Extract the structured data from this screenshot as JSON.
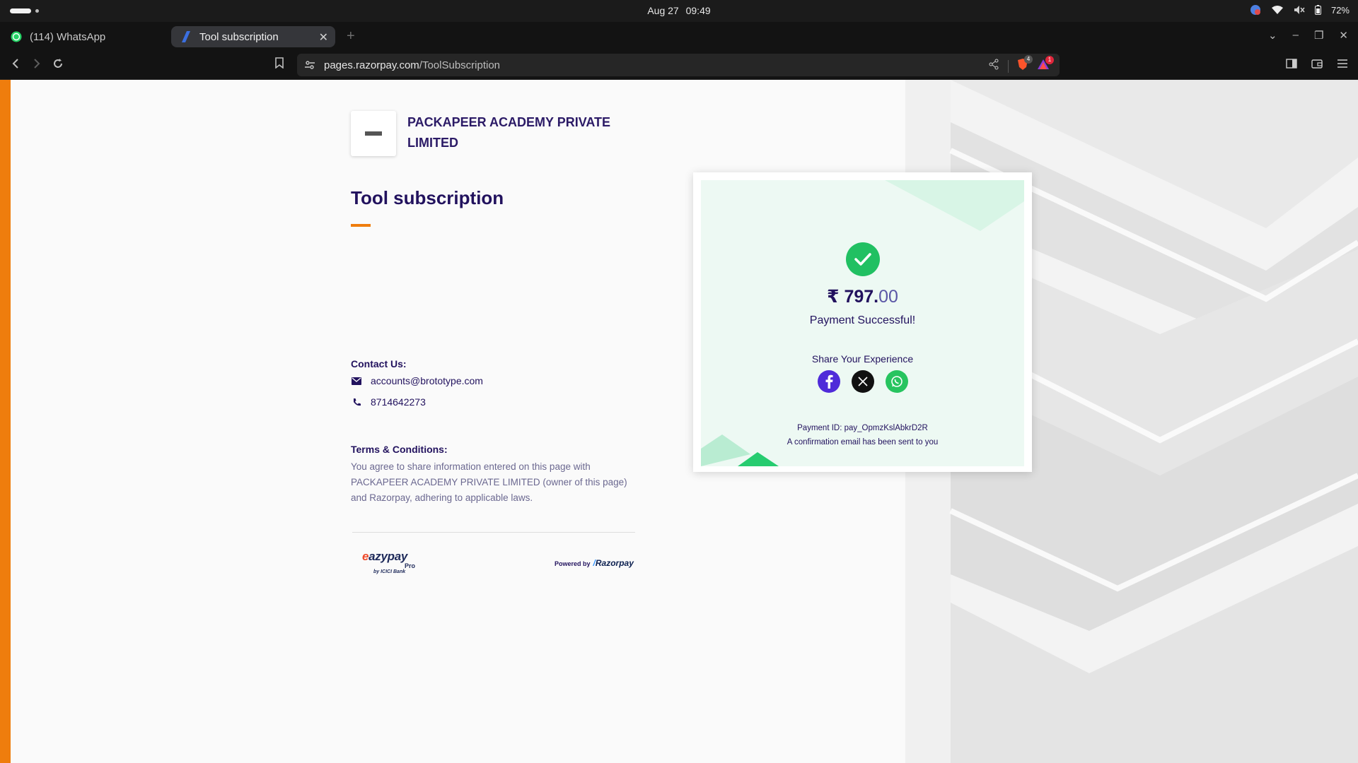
{
  "os": {
    "date": "Aug 27",
    "time": "09:49",
    "battery": "72%"
  },
  "browser": {
    "tabs": [
      {
        "label": "(114) WhatsApp",
        "icon": "whatsapp-icon",
        "active": false
      },
      {
        "label": "Tool subscription",
        "icon": "razorpay-icon",
        "active": true
      }
    ],
    "address": {
      "host": "pages.razorpay.com",
      "path": "/ToolSubscription"
    },
    "badges": {
      "shields": "4",
      "rewards": "1"
    }
  },
  "page": {
    "merchant_name": "PACKAPEER ACADEMY PRIVATE LIMITED",
    "title": "Tool subscription",
    "contact": {
      "heading": "Contact Us:",
      "email": "accounts@brototype.com",
      "phone": "8714642273"
    },
    "terms": {
      "heading": "Terms & Conditions:",
      "body": "You agree to share information entered on this page with PACKAPEER ACADEMY PRIVATE LIMITED (owner of this page) and Razorpay, adhering to applicable laws."
    },
    "footer": {
      "eazypay_e": "e",
      "eazypay_word": "azypay",
      "eazypay_pro": "Pro",
      "eazypay_by": "by ICICI Bank",
      "powered_by": "Powered by",
      "razorpay": "Razorpay"
    }
  },
  "receipt": {
    "currency_symbol": "₹",
    "amount_whole": "797.",
    "amount_decimal": "00",
    "status": "Payment Successful!",
    "share_label": "Share Your Experience",
    "social": [
      "facebook-icon",
      "x-icon",
      "whatsapp-icon"
    ],
    "payment_id": "Payment ID: pay_OpmzKslAbkrD2R",
    "confirmation": "A confirmation email has been sent to you"
  },
  "colors": {
    "accent": "#ef7d0d",
    "text_dark": "#22125e",
    "success": "#21c062",
    "card_tint": "#edf9f3"
  }
}
